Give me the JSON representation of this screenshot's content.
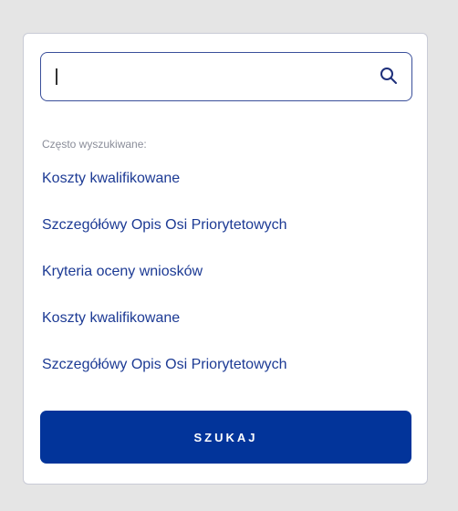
{
  "search": {
    "value": "",
    "placeholder": ""
  },
  "icons": {
    "search": "search-icon"
  },
  "popular": {
    "label": "Często wyszukiwane:",
    "items": [
      "Koszty kwalifikowane",
      "Szczegółówy Opis Osi Priorytetowych",
      "Kryteria oceny wniosków",
      "Koszty kwalifikowane",
      "Szczegółówy Opis Osi Priorytetowych"
    ]
  },
  "button": {
    "label": "SZUKAJ"
  },
  "colors": {
    "accent": "#02349a",
    "link": "#1c3a94",
    "background": "#e5e5e5"
  }
}
